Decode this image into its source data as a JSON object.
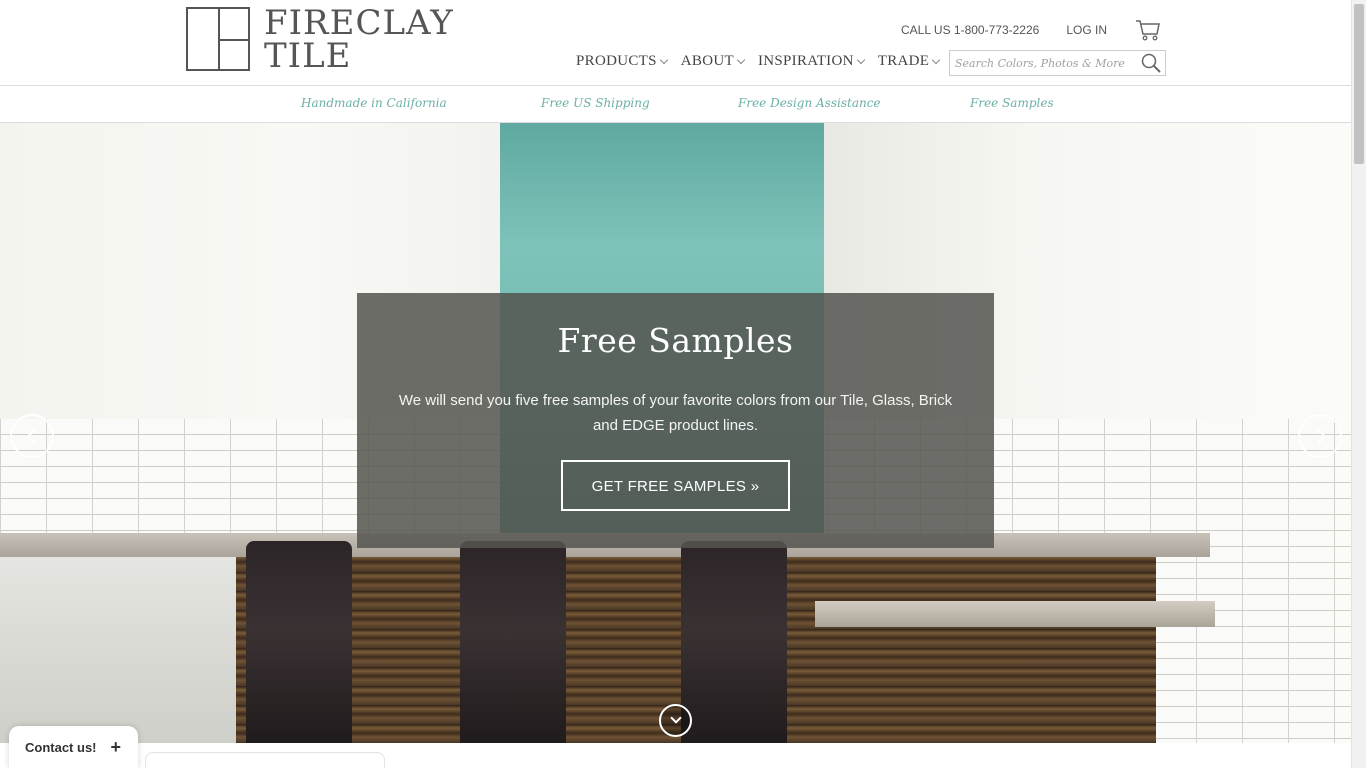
{
  "header": {
    "logo_line1": "FIRECLAY",
    "logo_line2": "TILE",
    "phone": "CALL US 1-800-773-2226",
    "login": "LOG IN",
    "nav": [
      {
        "label": "PRODUCTS"
      },
      {
        "label": "ABOUT"
      },
      {
        "label": "INSPIRATION"
      },
      {
        "label": "TRADE"
      }
    ],
    "search_placeholder": "Search Colors, Photos & More"
  },
  "promo": {
    "items": [
      "Handmade in California",
      "Free US Shipping",
      "Free Design Assistance",
      "Free Samples"
    ],
    "color": "#6bb0a5"
  },
  "hero": {
    "title": "Free Samples",
    "body": "We will send you five free samples of your favorite colors from our Tile, Glass, Brick and EDGE product lines.",
    "cta": "GET FREE SAMPLES »"
  },
  "widget": {
    "contact_label": "Contact us!",
    "contact_icon": "+"
  }
}
